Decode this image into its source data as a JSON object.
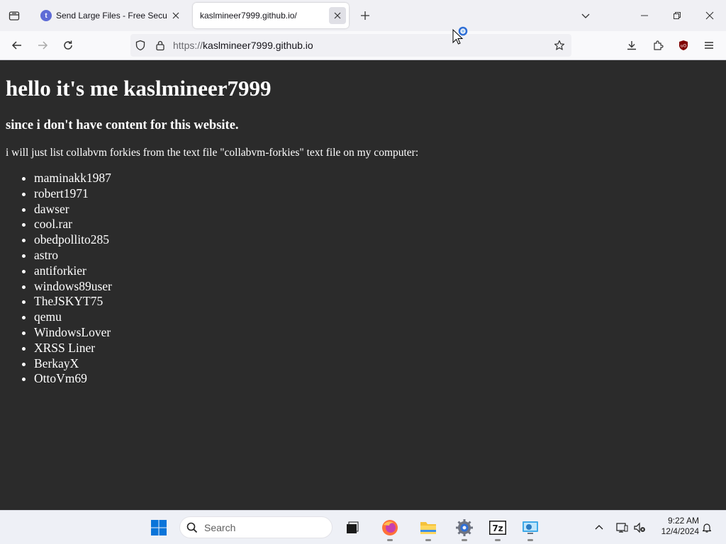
{
  "browser": {
    "tabs": [
      {
        "title": "Send Large Files - Free Secure File Transfer",
        "favicon": "t",
        "active": false
      },
      {
        "title": "kaslmineer7999.github.io/",
        "active": true
      }
    ],
    "url": {
      "scheme": "https://",
      "host": "kaslmineer7999.github.io"
    }
  },
  "page": {
    "heading": "hello it's me kaslmineer7999",
    "subheading": "since i don't have content for this website.",
    "intro": "i will just list collabvm forkies from the text file \"collabvm-forkies\" text file on my computer:",
    "forkies": [
      "maminakk1987",
      "robert1971",
      "dawser",
      "cool.rar",
      "obedpollito285",
      "astro",
      "antiforkier",
      "windows89user",
      "TheJSKYT75",
      "qemu",
      "WindowsLover",
      "XRSS Liner",
      "BerkayX",
      "OttoVm69"
    ]
  },
  "taskbar": {
    "search_placeholder": "Search",
    "time": "9:22 AM",
    "date": "12/4/2024"
  },
  "colors": {
    "page_background": "#2b2b2b",
    "page_text": "#ffffff",
    "windows_blue": "#0a74d9",
    "ublock_red": "#800000"
  }
}
